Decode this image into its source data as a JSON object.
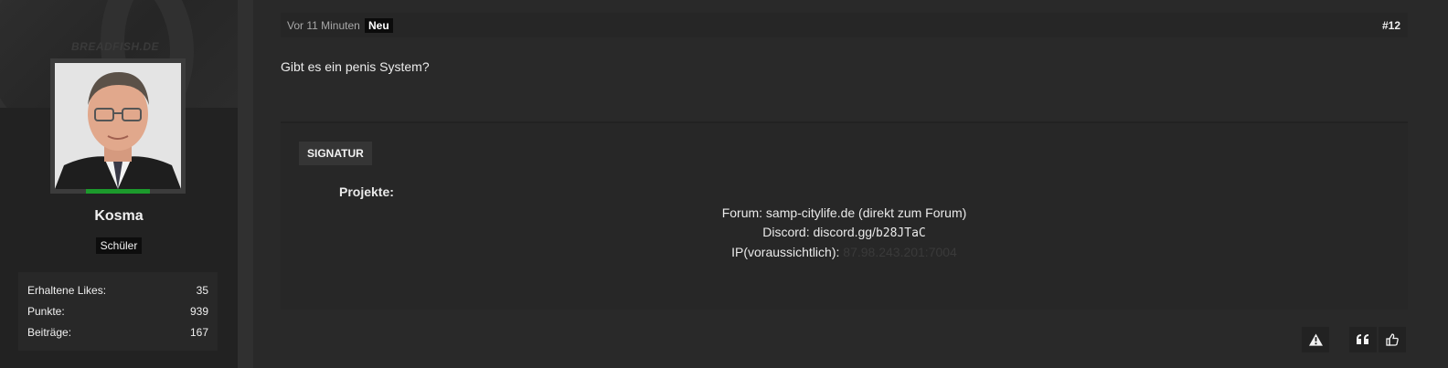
{
  "sidebar": {
    "banner_text": "BREADFISH.DE",
    "username": "Kosma",
    "rank": "Schüler",
    "online_color": "#1c9a2c",
    "stats": [
      {
        "label": "Erhaltene Likes:",
        "value": "35"
      },
      {
        "label": "Punkte:",
        "value": "939"
      },
      {
        "label": "Beiträge:",
        "value": "167"
      }
    ]
  },
  "post": {
    "time": "Vor 11 Minuten",
    "badge": "Neu",
    "number": "#12",
    "content": "Gibt es ein penis System?"
  },
  "signature": {
    "label": "SIGNATUR",
    "projects": "Projekte:",
    "forum_label": "Forum: samp-citylife.de (direkt zum Forum)",
    "discord_label": "Discord: discord.gg/",
    "discord_code": "b28JTaC",
    "ip_label": "IP(voraussichtlich):",
    "ip_value": "87.98.243.201:7004"
  },
  "actions": {
    "report": "report-icon",
    "quote": "quote-icon",
    "like": "thumbs-up-icon"
  }
}
